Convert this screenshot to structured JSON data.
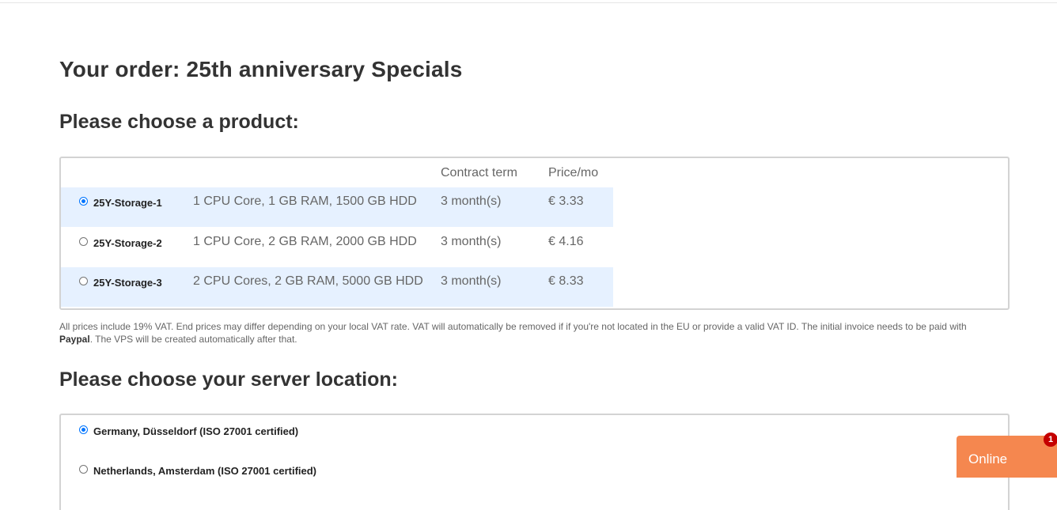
{
  "page": {
    "title": "Your order: 25th anniversary Specials"
  },
  "product_section": {
    "heading": "Please choose a product:",
    "columns": {
      "term": "Contract term",
      "price": "Price/mo"
    },
    "selected": "25Y-Storage-1",
    "products": [
      {
        "name": "25Y-Storage-1",
        "spec": "1 CPU Core, 1 GB RAM, 1500 GB HDD",
        "term": "3 month(s)",
        "price": "€ 3.33",
        "selected": true
      },
      {
        "name": "25Y-Storage-2",
        "spec": "1 CPU Core, 2 GB RAM, 2000 GB HDD",
        "term": "3 month(s)",
        "price": "€ 4.16",
        "selected": false
      },
      {
        "name": "25Y-Storage-3",
        "spec": "2 CPU Cores, 2 GB RAM, 5000 GB HDD",
        "term": "3 month(s)",
        "price": "€ 8.33",
        "selected": false
      }
    ],
    "vat_note_prefix": "All prices include 19% VAT. End prices may differ depending on your local VAT rate. VAT will automatically be removed if if you're not located in the EU or provide a valid VAT ID. The initial invoice needs to be paid with ",
    "vat_note_payment": "Paypal",
    "vat_note_suffix": ". The VPS will be created automatically after that."
  },
  "location_section": {
    "heading": "Please choose your server location:",
    "selected": "Germany, Düsseldorf (ISO 27001 certified)",
    "locations": [
      {
        "name": "Germany, Düsseldorf (ISO 27001 certified)",
        "selected": true
      },
      {
        "name": "Netherlands, Amsterdam (ISO 27001 certified)",
        "selected": false
      }
    ]
  },
  "chat_widget": {
    "label": "Online",
    "badge_count": "1"
  },
  "colors": {
    "row_highlight": "#e6f1ff",
    "radio_selected": "#0075ff",
    "chat_widget": "#f5874f",
    "badge": "#c40000",
    "text_dark": "#333333",
    "text_muted": "#666666"
  }
}
